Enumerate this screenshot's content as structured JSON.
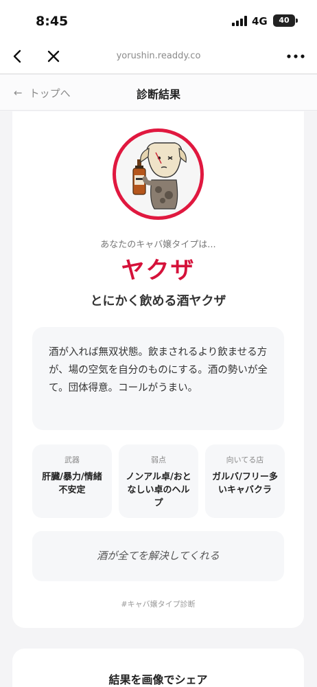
{
  "status_bar": {
    "time": "8:45",
    "network": "4G",
    "battery": "40"
  },
  "browser": {
    "url": "yorushin.readdy.co"
  },
  "header": {
    "back_label": "トップへ",
    "back_arrow": "←",
    "title": "診断結果"
  },
  "result": {
    "intro": "あなたのキャバ嬢タイプは...",
    "type_name": "ヤクザ",
    "subtitle": "とにかく飲める酒ヤクザ",
    "description": "酒が入れば無双状態。飲まされるより飲ませる方が、場の空気を自分のものにする。酒の勢いが全て。団体得意。コールがうまい。",
    "stats": [
      {
        "label": "武器",
        "value": "肝臓/暴力/情緒不安定"
      },
      {
        "label": "弱点",
        "value": "ノンアル卓/おとなしい卓のヘルプ"
      },
      {
        "label": "向いてる店",
        "value": "ガルバ/フリー多いキャバクラ"
      }
    ],
    "quote": "酒が全てを解決してくれる",
    "hashtag": "#キャバ嬢タイプ診断"
  },
  "share": {
    "title": "結果を画像でシェア"
  },
  "colors": {
    "accent": "#d5123a",
    "avatar_ring": "#e0183f"
  },
  "icons": [
    "signal-icon",
    "battery-icon",
    "back-chevron-icon",
    "close-icon",
    "more-icon",
    "back-arrow-icon",
    "character-illustration"
  ]
}
